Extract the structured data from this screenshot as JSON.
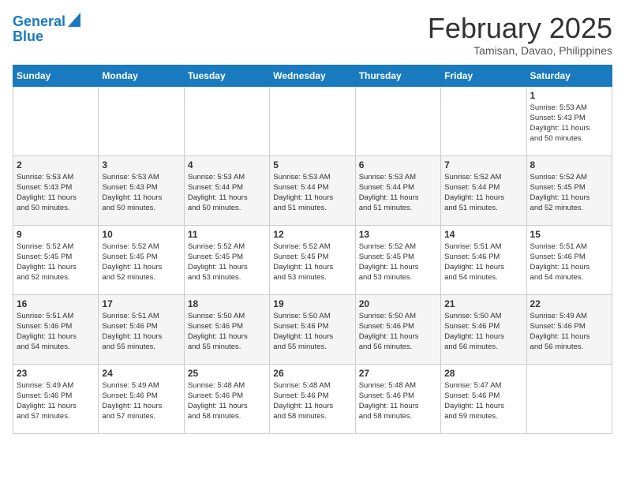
{
  "header": {
    "logo_line1": "General",
    "logo_line2": "Blue",
    "month_title": "February 2025",
    "location": "Tamisan, Davao, Philippines"
  },
  "days_of_week": [
    "Sunday",
    "Monday",
    "Tuesday",
    "Wednesday",
    "Thursday",
    "Friday",
    "Saturday"
  ],
  "weeks": [
    [
      {
        "day": "",
        "info": ""
      },
      {
        "day": "",
        "info": ""
      },
      {
        "day": "",
        "info": ""
      },
      {
        "day": "",
        "info": ""
      },
      {
        "day": "",
        "info": ""
      },
      {
        "day": "",
        "info": ""
      },
      {
        "day": "1",
        "info": "Sunrise: 5:53 AM\nSunset: 5:43 PM\nDaylight: 11 hours\nand 50 minutes."
      }
    ],
    [
      {
        "day": "2",
        "info": "Sunrise: 5:53 AM\nSunset: 5:43 PM\nDaylight: 11 hours\nand 50 minutes."
      },
      {
        "day": "3",
        "info": "Sunrise: 5:53 AM\nSunset: 5:43 PM\nDaylight: 11 hours\nand 50 minutes."
      },
      {
        "day": "4",
        "info": "Sunrise: 5:53 AM\nSunset: 5:44 PM\nDaylight: 11 hours\nand 50 minutes."
      },
      {
        "day": "5",
        "info": "Sunrise: 5:53 AM\nSunset: 5:44 PM\nDaylight: 11 hours\nand 51 minutes."
      },
      {
        "day": "6",
        "info": "Sunrise: 5:53 AM\nSunset: 5:44 PM\nDaylight: 11 hours\nand 51 minutes."
      },
      {
        "day": "7",
        "info": "Sunrise: 5:52 AM\nSunset: 5:44 PM\nDaylight: 11 hours\nand 51 minutes."
      },
      {
        "day": "8",
        "info": "Sunrise: 5:52 AM\nSunset: 5:45 PM\nDaylight: 11 hours\nand 52 minutes."
      }
    ],
    [
      {
        "day": "9",
        "info": "Sunrise: 5:52 AM\nSunset: 5:45 PM\nDaylight: 11 hours\nand 52 minutes."
      },
      {
        "day": "10",
        "info": "Sunrise: 5:52 AM\nSunset: 5:45 PM\nDaylight: 11 hours\nand 52 minutes."
      },
      {
        "day": "11",
        "info": "Sunrise: 5:52 AM\nSunset: 5:45 PM\nDaylight: 11 hours\nand 53 minutes."
      },
      {
        "day": "12",
        "info": "Sunrise: 5:52 AM\nSunset: 5:45 PM\nDaylight: 11 hours\nand 53 minutes."
      },
      {
        "day": "13",
        "info": "Sunrise: 5:52 AM\nSunset: 5:45 PM\nDaylight: 11 hours\nand 53 minutes."
      },
      {
        "day": "14",
        "info": "Sunrise: 5:51 AM\nSunset: 5:46 PM\nDaylight: 11 hours\nand 54 minutes."
      },
      {
        "day": "15",
        "info": "Sunrise: 5:51 AM\nSunset: 5:46 PM\nDaylight: 11 hours\nand 54 minutes."
      }
    ],
    [
      {
        "day": "16",
        "info": "Sunrise: 5:51 AM\nSunset: 5:46 PM\nDaylight: 11 hours\nand 54 minutes."
      },
      {
        "day": "17",
        "info": "Sunrise: 5:51 AM\nSunset: 5:46 PM\nDaylight: 11 hours\nand 55 minutes."
      },
      {
        "day": "18",
        "info": "Sunrise: 5:50 AM\nSunset: 5:46 PM\nDaylight: 11 hours\nand 55 minutes."
      },
      {
        "day": "19",
        "info": "Sunrise: 5:50 AM\nSunset: 5:46 PM\nDaylight: 11 hours\nand 55 minutes."
      },
      {
        "day": "20",
        "info": "Sunrise: 5:50 AM\nSunset: 5:46 PM\nDaylight: 11 hours\nand 56 minutes."
      },
      {
        "day": "21",
        "info": "Sunrise: 5:50 AM\nSunset: 5:46 PM\nDaylight: 11 hours\nand 56 minutes."
      },
      {
        "day": "22",
        "info": "Sunrise: 5:49 AM\nSunset: 5:46 PM\nDaylight: 11 hours\nand 56 minutes."
      }
    ],
    [
      {
        "day": "23",
        "info": "Sunrise: 5:49 AM\nSunset: 5:46 PM\nDaylight: 11 hours\nand 57 minutes."
      },
      {
        "day": "24",
        "info": "Sunrise: 5:49 AM\nSunset: 5:46 PM\nDaylight: 11 hours\nand 57 minutes."
      },
      {
        "day": "25",
        "info": "Sunrise: 5:48 AM\nSunset: 5:46 PM\nDaylight: 11 hours\nand 58 minutes."
      },
      {
        "day": "26",
        "info": "Sunrise: 5:48 AM\nSunset: 5:46 PM\nDaylight: 11 hours\nand 58 minutes."
      },
      {
        "day": "27",
        "info": "Sunrise: 5:48 AM\nSunset: 5:46 PM\nDaylight: 11 hours\nand 58 minutes."
      },
      {
        "day": "28",
        "info": "Sunrise: 5:47 AM\nSunset: 5:46 PM\nDaylight: 11 hours\nand 59 minutes."
      },
      {
        "day": "",
        "info": ""
      }
    ]
  ]
}
